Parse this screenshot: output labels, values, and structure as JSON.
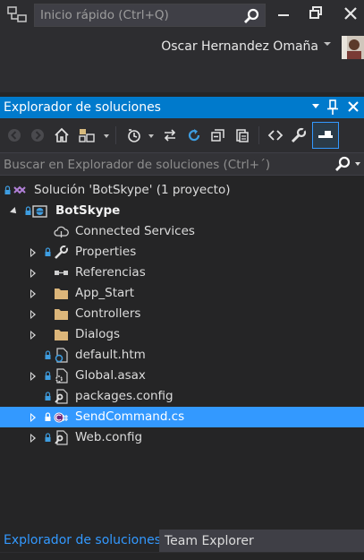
{
  "title_bar": {
    "quick_launch_placeholder": "Inicio rápido (Ctrl+Q)",
    "user_name": "Oscar Hernandez Omaña"
  },
  "panel": {
    "title": "Explorador de soluciones",
    "header_color": "#007acc"
  },
  "toolbar": {
    "icons": [
      "back-icon",
      "forward-icon",
      "home-icon",
      "switch-views-icon",
      "pending-changes-filter-icon",
      "sync-icon",
      "refresh-icon",
      "collapse-all-icon",
      "show-all-files-icon",
      "view-code-icon",
      "properties-icon",
      "preview-selected-icon"
    ]
  },
  "search": {
    "placeholder": "Buscar en Explorador de soluciones (Ctrl+´)"
  },
  "tree": {
    "solution": "Solución 'BotSkype'  (1 proyecto)",
    "project": "BotSkype",
    "items": [
      {
        "label": "Connected Services",
        "icon": "connected-services-icon"
      },
      {
        "label": "Properties",
        "icon": "wrench-icon"
      },
      {
        "label": "Referencias",
        "icon": "references-icon"
      },
      {
        "label": "App_Start",
        "icon": "folder-icon"
      },
      {
        "label": "Controllers",
        "icon": "folder-icon"
      },
      {
        "label": "Dialogs",
        "icon": "folder-icon"
      },
      {
        "label": "default.htm",
        "icon": "html-file-icon"
      },
      {
        "label": "Global.asax",
        "icon": "asax-file-icon"
      },
      {
        "label": "packages.config",
        "icon": "config-file-icon"
      },
      {
        "label": "SendCommand.cs",
        "icon": "csharp-file-icon",
        "selected": true
      },
      {
        "label": "Web.config",
        "icon": "config-file-icon"
      }
    ],
    "selected_color": "#3399ff"
  },
  "bottom_tabs": {
    "solution_explorer": "Explorador de soluciones",
    "team_explorer": "Team Explorer"
  }
}
